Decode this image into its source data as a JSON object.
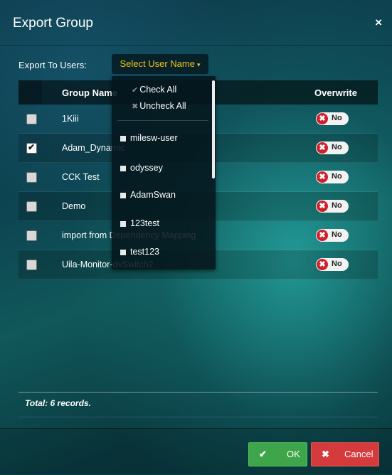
{
  "dialog": {
    "title": "Export Group",
    "close_icon": "×"
  },
  "export_to": {
    "label": "Export To Users:",
    "select_label": "Select User Name",
    "caret": "▾"
  },
  "table": {
    "headers": {
      "group_name": "Group Name",
      "overwrite": "Overwrite"
    },
    "rows": [
      {
        "name": "1Kiii",
        "checked": false,
        "overwrite": "No"
      },
      {
        "name": "Adam_Dynamic",
        "checked": true,
        "overwrite": "No"
      },
      {
        "name": "CCK Test",
        "checked": false,
        "overwrite": "No"
      },
      {
        "name": "Demo",
        "checked": false,
        "overwrite": "No"
      },
      {
        "name": "import from Dependency Mapping",
        "checked": false,
        "overwrite": "No"
      },
      {
        "name": "Uila-Monitor-dvSwitch2",
        "checked": false,
        "overwrite": "No"
      }
    ]
  },
  "dropdown": {
    "check_all": "Check All",
    "uncheck_all": "Uncheck All",
    "users": [
      "milesw-user",
      "odyssey",
      "AdamSwan",
      "123test",
      "test123"
    ]
  },
  "total": "Total: 6 records.",
  "buttons": {
    "ok": "OK",
    "cancel": "Cancel"
  },
  "colors": {
    "accent_yellow": "#f0c419",
    "ok_green": "#3fa54a",
    "cancel_red": "#d53a3d",
    "toggle_red": "#d0202a"
  }
}
